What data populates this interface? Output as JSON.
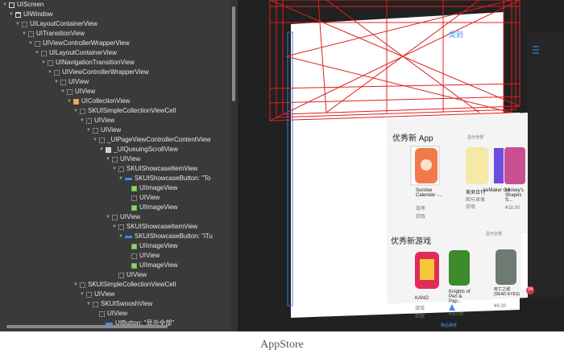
{
  "tree": {
    "rows": [
      {
        "label": "UIScreen",
        "icon": "screen"
      },
      {
        "label": "UIWindow",
        "icon": "window"
      },
      {
        "label": "UILayoutContainerView",
        "icon": "view"
      },
      {
        "label": "UITransitionView",
        "icon": "view"
      },
      {
        "label": "UIViewControllerWrapperView",
        "icon": "view"
      },
      {
        "label": "UILayoutContainerView",
        "icon": "view"
      },
      {
        "label": "UINavigationTransitionView",
        "icon": "view"
      },
      {
        "label": "UIViewControllerWrapperView",
        "icon": "view"
      },
      {
        "label": "UIView",
        "icon": "view"
      },
      {
        "label": "UIView",
        "icon": "view"
      },
      {
        "label": "UICollectionView",
        "icon": "collection"
      },
      {
        "label": "SKUISimpleCollectionViewCell",
        "icon": "view"
      },
      {
        "label": "UIView",
        "icon": "view"
      },
      {
        "label": "UIView",
        "icon": "view"
      },
      {
        "label": "_UIPageViewControllerContentView",
        "icon": "view"
      },
      {
        "label": "_UIQueuingScrollView",
        "icon": "scroll"
      },
      {
        "label": "UIView",
        "icon": "view"
      },
      {
        "label": "SKUIShowcaseItemView",
        "icon": "view"
      },
      {
        "label": "SKUIShowcaseButton: \"To",
        "icon": "button"
      },
      {
        "label": "UIImageView",
        "icon": "image"
      },
      {
        "label": "UIView",
        "icon": "view"
      },
      {
        "label": "UIImageView",
        "icon": "image"
      },
      {
        "label": "UIView",
        "icon": "view"
      },
      {
        "label": "SKUIShowcaseItemView",
        "icon": "view"
      },
      {
        "label": "SKUIShowcaseButton: \"iTu",
        "icon": "button"
      },
      {
        "label": "UIImageView",
        "icon": "image"
      },
      {
        "label": "UIView",
        "icon": "view"
      },
      {
        "label": "UIImageView",
        "icon": "image"
      },
      {
        "label": "UIView",
        "icon": "view"
      },
      {
        "label": "SKUISimpleCollectionViewCell",
        "icon": "view"
      },
      {
        "label": "UIView",
        "icon": "view"
      },
      {
        "label": "SKUISwooshView",
        "icon": "view"
      },
      {
        "label": "UIView",
        "icon": "view"
      },
      {
        "label": "UIButton: \"显示全部\"",
        "icon": "button"
      }
    ]
  },
  "scene": {
    "section1_title": "优秀新 App",
    "section1_more": "显示全部",
    "section2_title": "优秀新游戏",
    "section2_more": "显示全部",
    "nav_link": "类别",
    "app1_name": "Sunrise Calendar -...",
    "app1_category": "效率",
    "app1_action": "获取",
    "app2_name": "美来日刊",
    "app2_category": "图与录像",
    "app2_action": "获取",
    "app3_name": "keMaker Go",
    "app4_name": "Mickey's Shapes S...",
    "app4_price": "¥18.00",
    "game1_name": "KANO",
    "game1_category": "游戏",
    "game1_action": "获取",
    "game2_name": "Knights of Pen & Pap...",
    "game2_price": "¥30.00",
    "game3_name": "死亡之城 (DEAD EYES)",
    "game3_price": "¥6.00",
    "badge": "34",
    "tab_featured": "精品推荐"
  },
  "caption": "AppStore"
}
